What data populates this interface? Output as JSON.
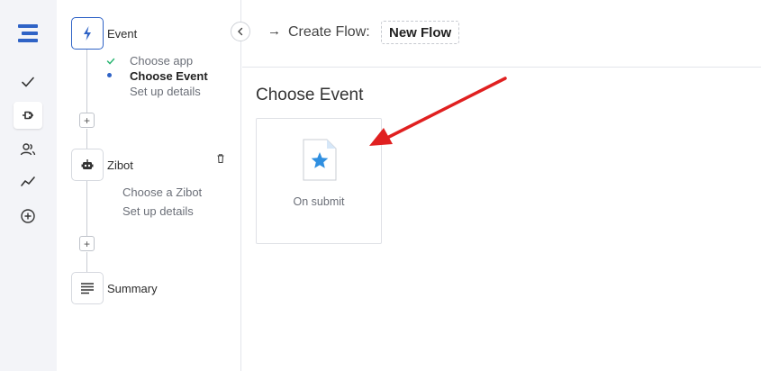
{
  "rail": {
    "items": [
      {
        "icon": "check-icon"
      },
      {
        "icon": "plug-icon",
        "active": true
      },
      {
        "icon": "users-icon"
      },
      {
        "icon": "activity-icon"
      },
      {
        "icon": "add-circle-icon"
      }
    ]
  },
  "flow": {
    "steps": [
      {
        "title": "Event",
        "subs": [
          "Choose app",
          "Choose Event",
          "Set up details"
        ]
      },
      {
        "title": "Zibot",
        "subs": [
          "Choose a Zibot",
          "Set up details"
        ]
      },
      {
        "title": "Summary"
      }
    ],
    "plus_label": "+"
  },
  "header": {
    "arrow": "→",
    "label": "Create Flow:",
    "flow_name": "New Flow"
  },
  "main": {
    "title": "Choose Event",
    "cards": [
      {
        "label": "On submit",
        "icon": "form-star-icon"
      }
    ]
  },
  "colors": {
    "accent": "#2f63c6",
    "check": "#2bb673",
    "star": "#2f8fe0",
    "annotation_arrow": "#e02020"
  }
}
